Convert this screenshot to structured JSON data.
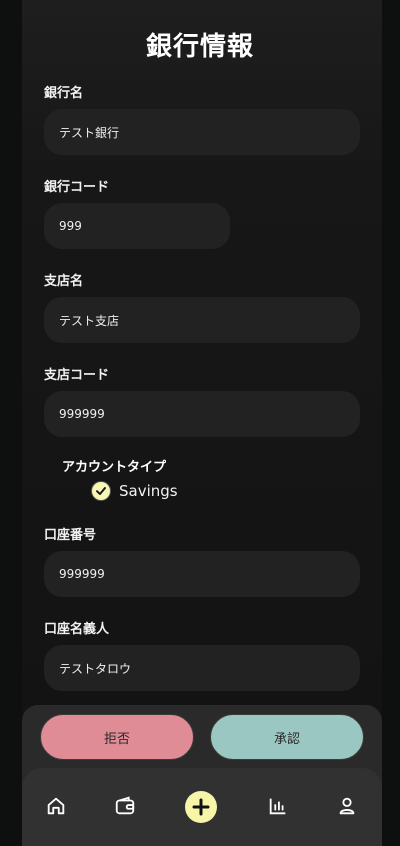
{
  "page": {
    "title": "銀行情報"
  },
  "form": {
    "bank_name": {
      "label": "銀行名",
      "value": "テスト銀行"
    },
    "bank_code": {
      "label": "銀行コード",
      "value": "999"
    },
    "branch_name": {
      "label": "支店名",
      "value": "テスト支店"
    },
    "branch_code": {
      "label": "支店コード",
      "value": "999999"
    },
    "account_type": {
      "label": "アカウントタイプ",
      "option": "Savings",
      "checked": true
    },
    "account_number": {
      "label": "口座番号",
      "value": "999999"
    },
    "account_holder": {
      "label": "口座名義人",
      "value": "テストタロウ"
    }
  },
  "actions": {
    "reject_label": "拒否",
    "approve_label": "承認",
    "reject_color": "#df8c96",
    "approve_color": "#9bc7c3"
  },
  "tabbar": {
    "items": [
      "home-icon",
      "wallet-icon",
      "add-icon",
      "chart-icon",
      "profile-icon"
    ],
    "accent": "#f7f5a8"
  }
}
